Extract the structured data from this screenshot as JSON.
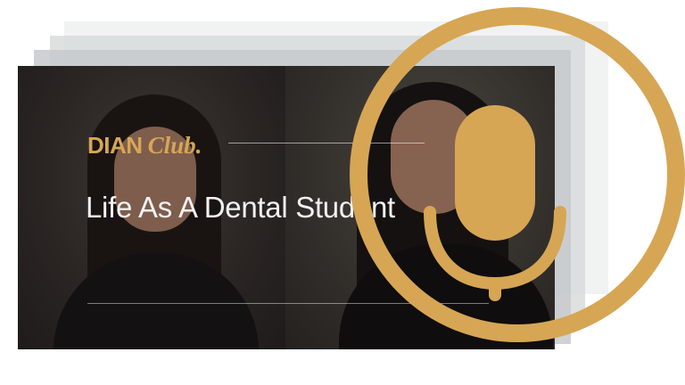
{
  "brand": {
    "name": "DIAN",
    "club": "Club."
  },
  "video": {
    "title": "Life As A Dental Student"
  },
  "icons": {
    "badge": "microphone-icon"
  },
  "colors": {
    "accent": "#d6a654",
    "title_text": "#f2f2f2"
  }
}
